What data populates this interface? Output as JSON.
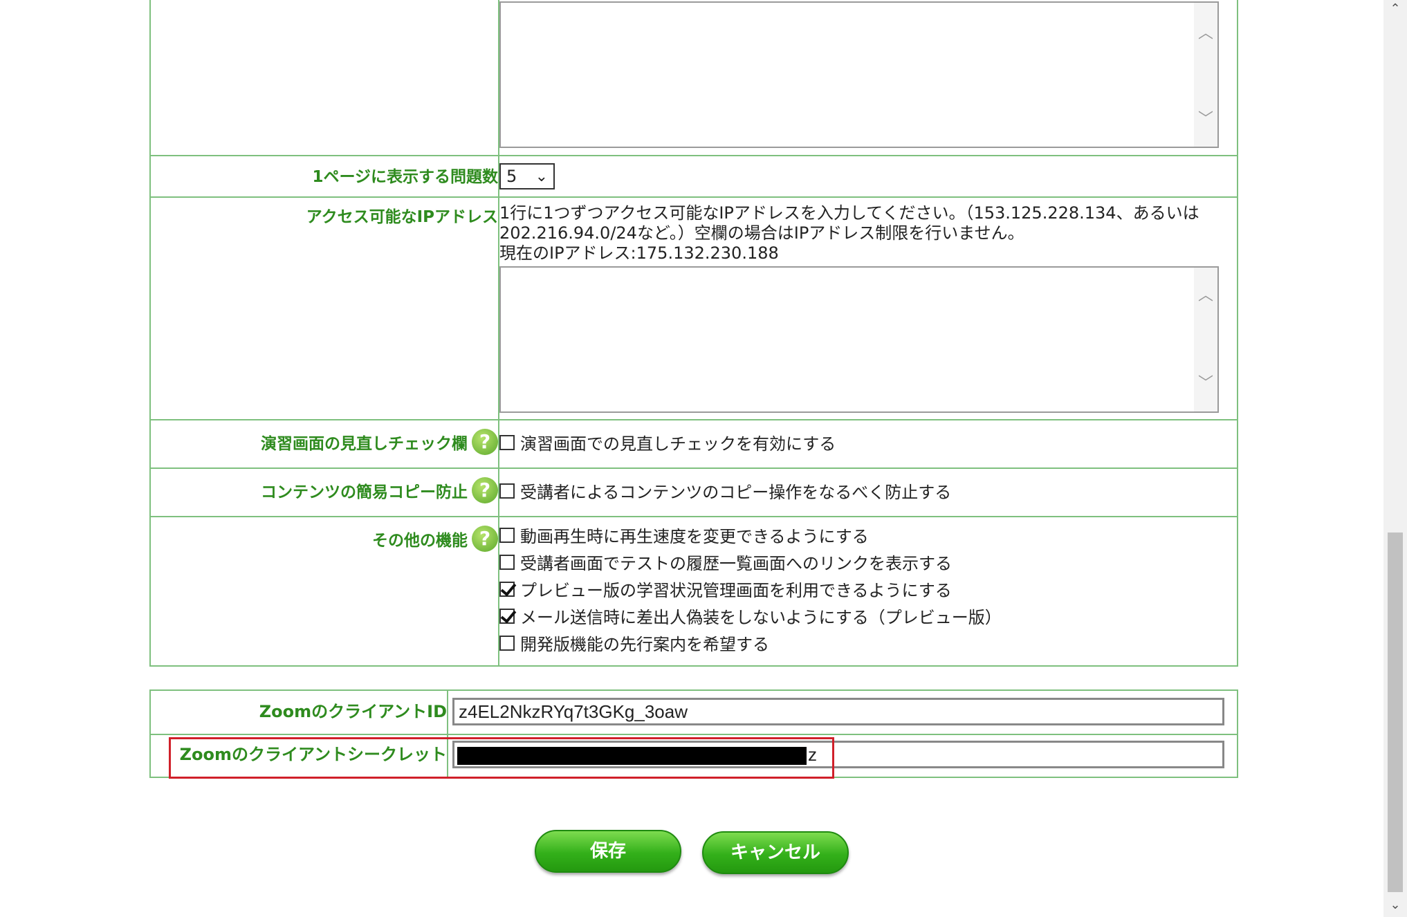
{
  "settings": {
    "per_page": {
      "label": "1ページに表示する問題数",
      "value": "5"
    },
    "ip": {
      "label": "アクセス可能なIPアドレス",
      "description_line1": "1行に1つずつアクセス可能なIPアドレスを入力してください。（153.125.228.134、あるいは",
      "description_line2": "202.216.94.0/24など。）空欄の場合はIPアドレス制限を行いません。",
      "current_ip": "現在のIPアドレス:175.132.230.188"
    },
    "review_check": {
      "label": "演習画面の見直しチェック欄",
      "option": "演習画面での見直しチェックを有効にする",
      "checked": false
    },
    "copy_protect": {
      "label": "コンテンツの簡易コピー防止",
      "option": "受講者によるコンテンツのコピー操作をなるべく防止する",
      "checked": false
    },
    "other": {
      "label": "その他の機能",
      "options": [
        {
          "text": "動画再生時に再生速度を変更できるようにする",
          "checked": false
        },
        {
          "text": "受講者画面でテストの履歴一覧画面へのリンクを表示する",
          "checked": false
        },
        {
          "text": "プレビュー版の学習状況管理画面を利用できるようにする",
          "checked": true
        },
        {
          "text": "メール送信時に差出人偽装をしないようにする（プレビュー版）",
          "checked": true
        },
        {
          "text": "開発版機能の先行案内を希望する",
          "checked": false
        }
      ]
    }
  },
  "zoom": {
    "client_id_label": "ZoomのクライアントID",
    "client_id_value": "z4EL2NkzRYq7t3GKg_3oaw",
    "client_secret_label": "Zoomのクライアントシークレット",
    "client_secret_visible_tail": "z"
  },
  "buttons": {
    "save": "保存",
    "cancel": "キャンセル"
  },
  "icons": {
    "help": "help-icon",
    "scroll_up": "arrow-up-icon",
    "scroll_down": "arrow-down-icon"
  },
  "colors": {
    "label_green": "#2e8b1e",
    "border_green": "#7ec07e",
    "button_green": "#33b01a",
    "highlight_red": "#d0202a"
  }
}
